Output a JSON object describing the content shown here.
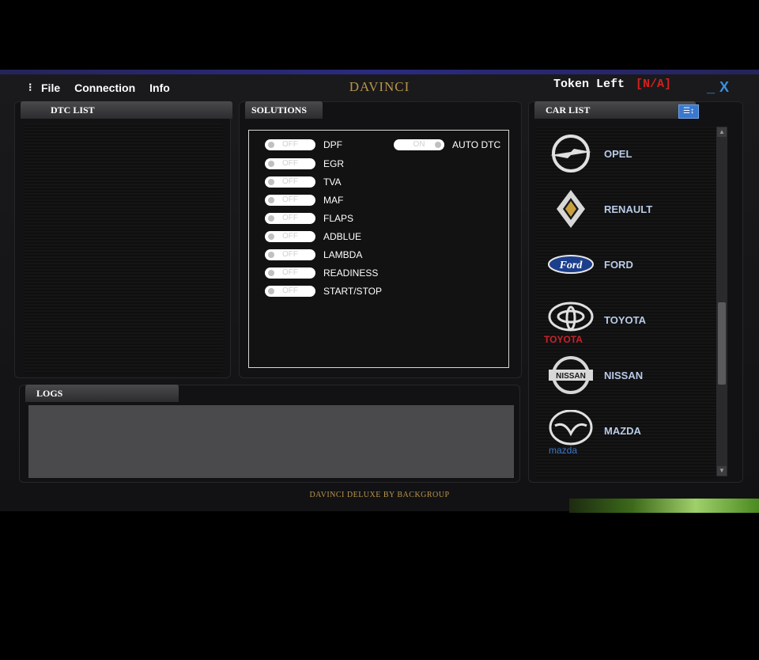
{
  "app": {
    "title": "DAVINCI",
    "footer": "DAVINCI DELUXE BY BACKGROUP"
  },
  "menu": {
    "items": [
      "File",
      "Connection",
      "Info"
    ]
  },
  "token": {
    "label": "Token Left",
    "value": "[N/A]"
  },
  "window_controls": {
    "minimize": "_",
    "close": "X"
  },
  "panels": {
    "dtc_list": "DTC LIST",
    "solutions": "SOLUTIONS",
    "logs": "LOGS",
    "car_list": "CAR LIST"
  },
  "solutions": {
    "items": [
      {
        "label": "DPF",
        "state": "OFF"
      },
      {
        "label": "EGR",
        "state": "OFF"
      },
      {
        "label": "TVA",
        "state": "OFF"
      },
      {
        "label": "MAF",
        "state": "OFF"
      },
      {
        "label": "FLAPS",
        "state": "OFF"
      },
      {
        "label": "ADBLUE",
        "state": "OFF"
      },
      {
        "label": "LAMBDA",
        "state": "OFF"
      },
      {
        "label": "READINESS",
        "state": "OFF"
      },
      {
        "label": "START/STOP",
        "state": "OFF"
      }
    ],
    "auto_dtc": {
      "label": "AUTO DTC",
      "state": "ON"
    }
  },
  "cars": [
    {
      "name": "OPEL",
      "sub": "",
      "icon": "opel-logo-icon"
    },
    {
      "name": "RENAULT",
      "sub": "",
      "icon": "renault-logo-icon"
    },
    {
      "name": "FORD",
      "sub": "",
      "icon": "ford-logo-icon"
    },
    {
      "name": "TOYOTA",
      "sub": "TOYOTA",
      "icon": "toyota-logo-icon",
      "sub_color": "#c8242b"
    },
    {
      "name": "NISSAN",
      "sub": "",
      "icon": "nissan-logo-icon"
    },
    {
      "name": "MAZDA",
      "sub": "mazda",
      "icon": "mazda-logo-icon",
      "sub_color": "#3c78c8"
    }
  ],
  "colors": {
    "title_gold": "#b8954a",
    "accent_blue": "#3a78d0",
    "token_red": "#d32020",
    "car_name": "#b9cbe6"
  }
}
